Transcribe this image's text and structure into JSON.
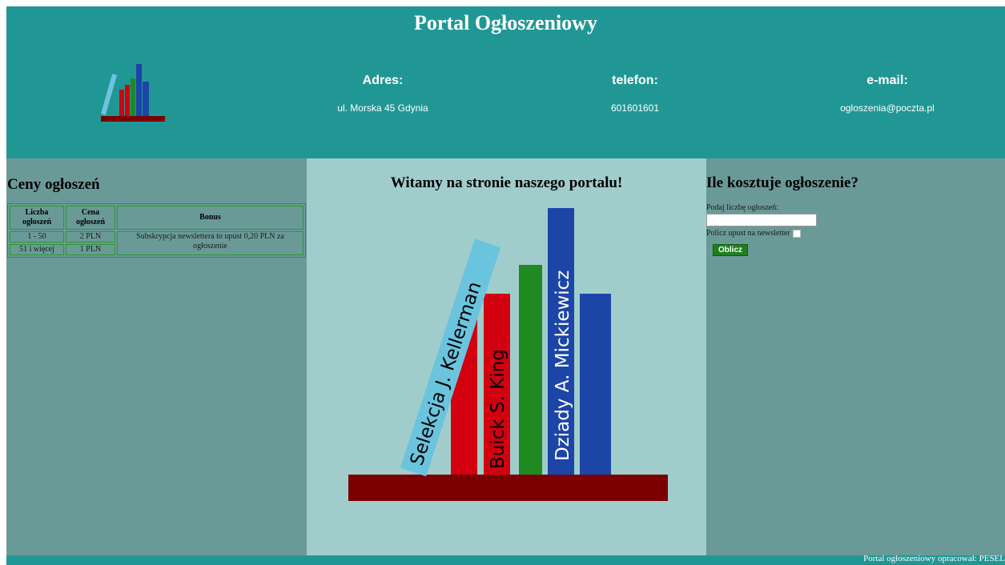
{
  "header": {
    "title": "Portal Ogłoszeniowy",
    "address": {
      "label": "Adres:",
      "value": "ul. Morska 45 Gdynia"
    },
    "phone": {
      "label": "telefon:",
      "value": "601601601"
    },
    "email": {
      "label": "e-mail:",
      "value": "ogloszenia@poczta.pl"
    }
  },
  "left": {
    "title": "Ceny ogłoszeń",
    "table": {
      "headers": [
        "Liczba ogłoszeń",
        "Cena ogłoszeń",
        "Bonus"
      ],
      "rows": [
        {
          "count": "1 - 50",
          "price": "2 PLN"
        },
        {
          "count": "51 i więcej",
          "price": "1 PLN"
        }
      ],
      "bonus": "Subskrypcja newslettera to upust 0,20 PLN za ogłoszenie"
    }
  },
  "center": {
    "title": "Witamy na stronie naszego portalu!",
    "books": [
      "Selekcja J. Kellerman",
      "Buick S. King",
      "Dziady A. Mickiewicz"
    ]
  },
  "right": {
    "title": "Ile kosztuje ogłoszenie?",
    "count_label": "Podaj liczbę ogłoszeń:",
    "count_value": "",
    "newsletter_label": "Policz upust na newsletter",
    "button_label": "Oblicz"
  },
  "footer": {
    "text": "Portal ogłoszeniowy opracował: PESEL"
  },
  "colors": {
    "header": "#219795",
    "side": "#6a9a98",
    "center": "#a0cdcc",
    "shelf": "#7a0000",
    "red": "#d30010",
    "green": "#1f8a22",
    "blue": "#1c45a8",
    "lightblue": "#6bc4de"
  }
}
